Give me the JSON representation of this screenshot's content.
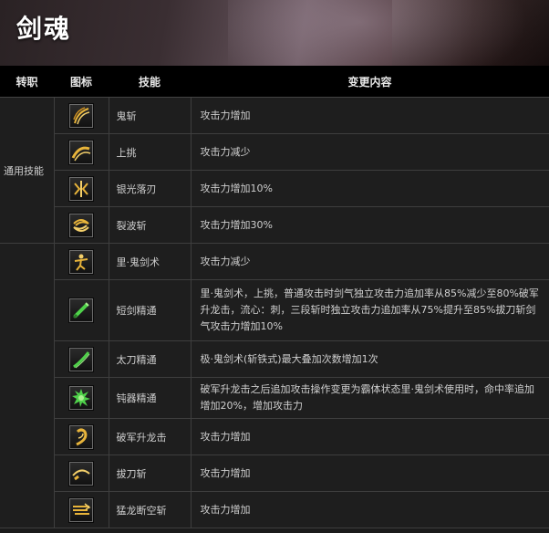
{
  "title": "剑魂",
  "headers": {
    "class": "转职",
    "icon": "图标",
    "skill": "技能",
    "change": "变更内容"
  },
  "groups": [
    {
      "label": "通用技能"
    },
    {
      "label": ""
    }
  ],
  "rows": [
    {
      "skill": "鬼斩",
      "change": "攻击力增加",
      "icon": "ghost-slash-icon"
    },
    {
      "skill": "上挑",
      "change": "攻击力减少",
      "icon": "upward-slash-icon"
    },
    {
      "skill": "银光落刃",
      "change": "攻击力增加10%",
      "icon": "silver-blade-icon"
    },
    {
      "skill": "裂波斩",
      "change": "攻击力增加30%",
      "icon": "wave-slash-icon"
    },
    {
      "skill": "里·鬼剑术",
      "change": "攻击力减少",
      "icon": "inner-sword-icon"
    },
    {
      "skill": "短剑精通",
      "change": "里·鬼剑术，上挑，普通攻击时剑气独立攻击力追加率从85%减少至80%破军升龙击，流心：刺，三段斩时独立攻击力追加率从75%提升至85%拔刀斩剑气攻击力增加10%",
      "icon": "short-sword-icon"
    },
    {
      "skill": "太刀精通",
      "change": "极·鬼剑术(斩铁式)最大叠加次数增加1次",
      "icon": "katana-icon"
    },
    {
      "skill": "钝器精通",
      "change": "破军升龙击之后追加攻击操作变更为霸体状态里·鬼剑术使用时，命中率追加增加20%，增加攻击力",
      "icon": "blunt-weapon-icon"
    },
    {
      "skill": "破军升龙击",
      "change": "攻击力增加",
      "icon": "rising-dragon-icon"
    },
    {
      "skill": "拔刀斩",
      "change": "攻击力增加",
      "icon": "draw-slash-icon"
    },
    {
      "skill": "猛龙断空斩",
      "change": "攻击力增加",
      "icon": "dragon-sky-slash-icon"
    }
  ],
  "colors": {
    "icon_gold": "#e8b43a",
    "icon_green": "#4fd24a",
    "header_bg": "#000000",
    "cell_bg": "#1e1e1e",
    "border": "#3e3e3e"
  }
}
